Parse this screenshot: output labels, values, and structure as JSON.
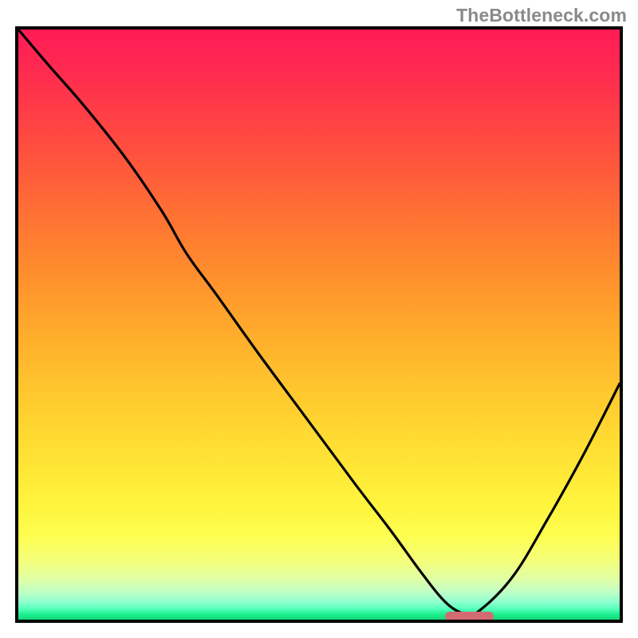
{
  "watermark": "TheBottleneck.com",
  "chart_data": {
    "type": "line",
    "title": "",
    "xlabel": "",
    "ylabel": "",
    "xlim": [
      0,
      100
    ],
    "ylim": [
      0,
      100
    ],
    "legend": false,
    "grid": false,
    "background": "rainbow-gradient",
    "series": [
      {
        "name": "bottleneck-curve",
        "x": [
          0,
          5,
          11,
          18,
          24,
          28,
          33,
          40,
          48,
          56,
          62,
          67,
          71,
          74,
          76,
          82,
          88,
          94,
          100
        ],
        "values": [
          100,
          94,
          87,
          78,
          69,
          62,
          55,
          45,
          34,
          23,
          15,
          8,
          3,
          1,
          1,
          7,
          17,
          28,
          40
        ]
      }
    ],
    "marker": {
      "name": "optimal-range",
      "x_start": 71,
      "x_end": 79,
      "y": 0.5,
      "color": "#d26a71"
    },
    "gradient_stops": [
      {
        "pos": 0,
        "color": "#ff1b55"
      },
      {
        "pos": 50,
        "color": "#ffb030"
      },
      {
        "pos": 85,
        "color": "#fff84a"
      },
      {
        "pos": 100,
        "color": "#11d878"
      }
    ]
  }
}
